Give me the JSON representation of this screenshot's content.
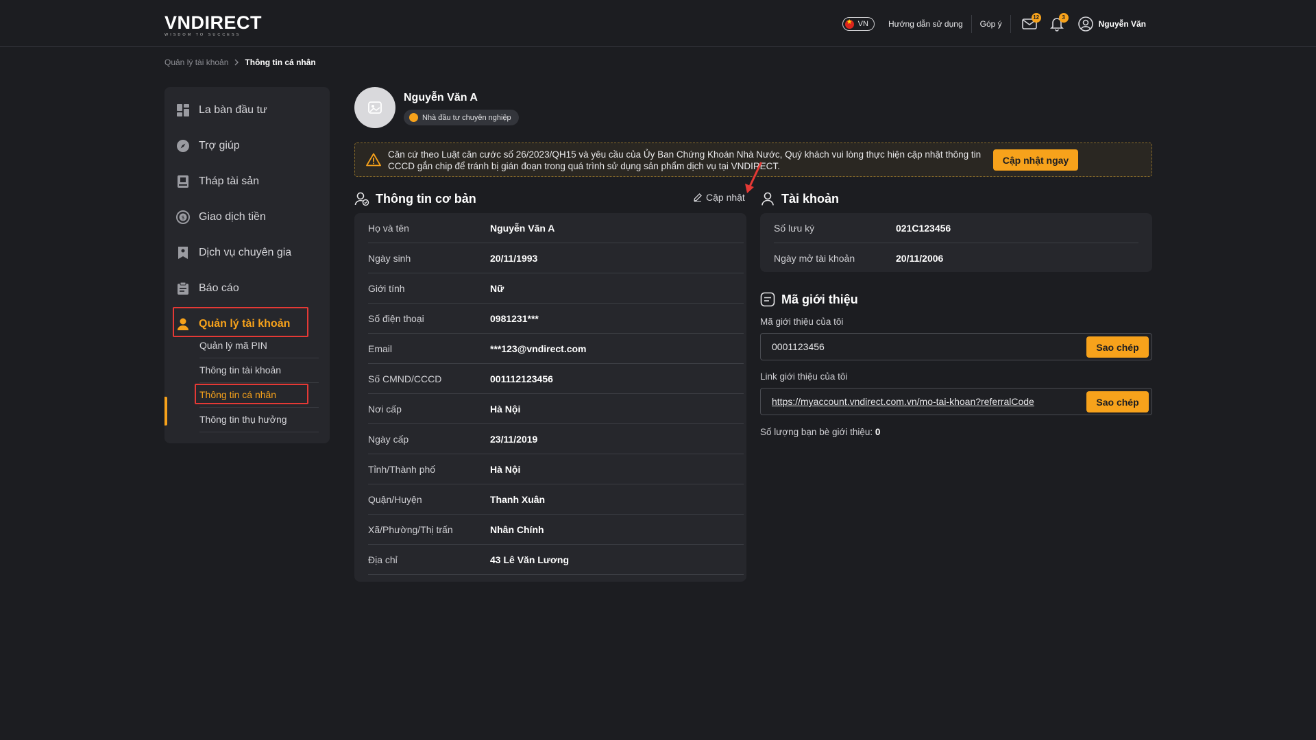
{
  "header": {
    "logo": "VNDIRECT",
    "logo_tagline": "WISDOM TO SUCCESS",
    "lang": "VN",
    "guide_link": "Hướng dẫn sử dụng",
    "feedback_link": "Góp ý",
    "mail_count": "12",
    "notif_count": "3",
    "user_name": "Nguyễn Văn"
  },
  "breadcrumb": {
    "parent": "Quản lý tài khoản",
    "current": "Thông tin cá nhân"
  },
  "sidebar": {
    "items": [
      {
        "label": "La bàn đầu tư",
        "icon": "dashboard-icon"
      },
      {
        "label": "Trợ giúp",
        "icon": "compass-icon"
      },
      {
        "label": "Tháp tài sản",
        "icon": "book-icon"
      },
      {
        "label": "Giao dịch tiền",
        "icon": "coin-icon"
      },
      {
        "label": "Dịch vụ chuyên gia",
        "icon": "bookmark-icon"
      },
      {
        "label": "Báo cáo",
        "icon": "clipboard-icon"
      },
      {
        "label": "Quản lý tài khoản",
        "icon": "user-icon"
      }
    ],
    "sub_items": [
      {
        "label": "Quản lý mã PIN"
      },
      {
        "label": "Thông tin tài khoản"
      },
      {
        "label": "Thông tin cá nhân"
      },
      {
        "label": "Thông tin thụ hưởng"
      }
    ]
  },
  "profile": {
    "name": "Nguyễn Văn A",
    "tag": "Nhà đầu tư chuyên nghiệp"
  },
  "notice": {
    "text": "Căn cứ theo Luật căn cước số 26/2023/QH15 và yêu cầu của Ủy Ban Chứng Khoán Nhà Nước, Quý khách vui lòng thực hiện cập nhật thông tin CCCD gắn chip để tránh bị gián đoạn trong quá trình sử dụng sản phẩm dịch vụ tại VNDIRECT.",
    "button": "Cập nhật ngay"
  },
  "basic_info": {
    "title": "Thông tin cơ bản",
    "edit_label": "Cập nhật",
    "rows": [
      {
        "label": "Họ và tên",
        "value": "Nguyễn Văn A"
      },
      {
        "label": "Ngày sinh",
        "value": "20/11/1993"
      },
      {
        "label": "Giới tính",
        "value": "Nữ"
      },
      {
        "label": "Số điện thoại",
        "value": "0981231***"
      },
      {
        "label": "Email",
        "value": "***123@vndirect.com"
      },
      {
        "label": "Số CMND/CCCD",
        "value": "001112123456"
      },
      {
        "label": "Nơi cấp",
        "value": "Hà Nội"
      },
      {
        "label": "Ngày cấp",
        "value": "23/11/2019"
      },
      {
        "label": "Tỉnh/Thành phố",
        "value": "Hà Nội"
      },
      {
        "label": "Quận/Huyện",
        "value": "Thanh Xuân"
      },
      {
        "label": "Xã/Phường/Thị trấn",
        "value": "Nhân Chính"
      },
      {
        "label": "Địa chỉ",
        "value": "43 Lê Văn Lương"
      }
    ]
  },
  "account": {
    "title": "Tài khoản",
    "rows": [
      {
        "label": "Số lưu ký",
        "value": "021C123456"
      },
      {
        "label": "Ngày mở tài khoản",
        "value": "20/11/2006"
      }
    ]
  },
  "referral": {
    "title": "Mã giới thiệu",
    "code_label": "Mã giới thiệu của tôi",
    "code_value": "0001123456",
    "link_label": "Link giới thiệu của tôi",
    "link_value": "https://myaccount.vndirect.com.vn/mo-tai-khoan?referralCode",
    "copy_label": "Sao chép",
    "friends_label": "Số lượng bạn bè giới thiệu:",
    "friends_count": "0"
  },
  "colors": {
    "background": "#1c1d21",
    "card": "#26272c",
    "accent": "#f7a21b",
    "highlight": "#e53935"
  }
}
